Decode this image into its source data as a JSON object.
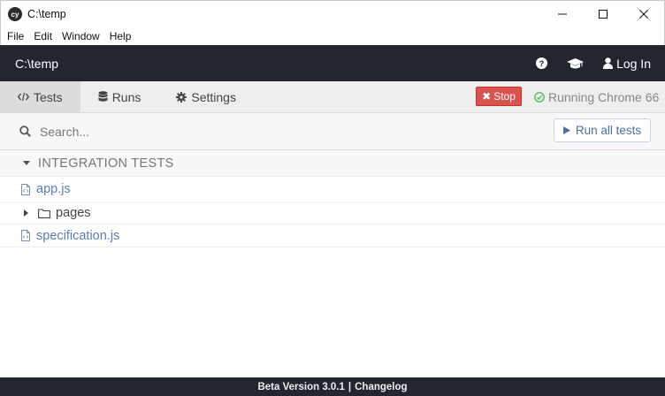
{
  "window": {
    "title": "C:\\temp",
    "logo_text": "cy",
    "controls": [
      "minimize-icon",
      "maximize-icon",
      "close-icon"
    ]
  },
  "menu": {
    "items": [
      "File",
      "Edit",
      "Window",
      "Help"
    ]
  },
  "header": {
    "project_path": "C:\\temp",
    "login_label": "Log In",
    "icons": [
      "help-icon",
      "graduation-cap-icon",
      "user-icon"
    ]
  },
  "tabs": {
    "items": [
      {
        "label": "Tests",
        "icon": "code-icon",
        "active": true
      },
      {
        "label": "Runs",
        "icon": "database-icon",
        "active": false
      },
      {
        "label": "Settings",
        "icon": "gear-icon",
        "active": false
      }
    ],
    "stop_label": "Stop",
    "running_label": "Running Chrome 66"
  },
  "search": {
    "placeholder": "Search...",
    "value": "",
    "run_all_label": "Run all tests"
  },
  "specs": {
    "group_label": "INTEGRATION TESTS",
    "items": [
      {
        "type": "file",
        "label": "app.js"
      },
      {
        "type": "folder",
        "label": "pages"
      },
      {
        "type": "file",
        "label": "specification.js"
      }
    ]
  },
  "footer": {
    "version_label": "Beta Version 3.0.1",
    "separator": "|",
    "changelog_label": "Changelog"
  },
  "colors": {
    "header_bg": "#23262f",
    "stop_red": "#d9534f",
    "running_green": "#5cb85c",
    "link_blue": "#5a7db7"
  }
}
